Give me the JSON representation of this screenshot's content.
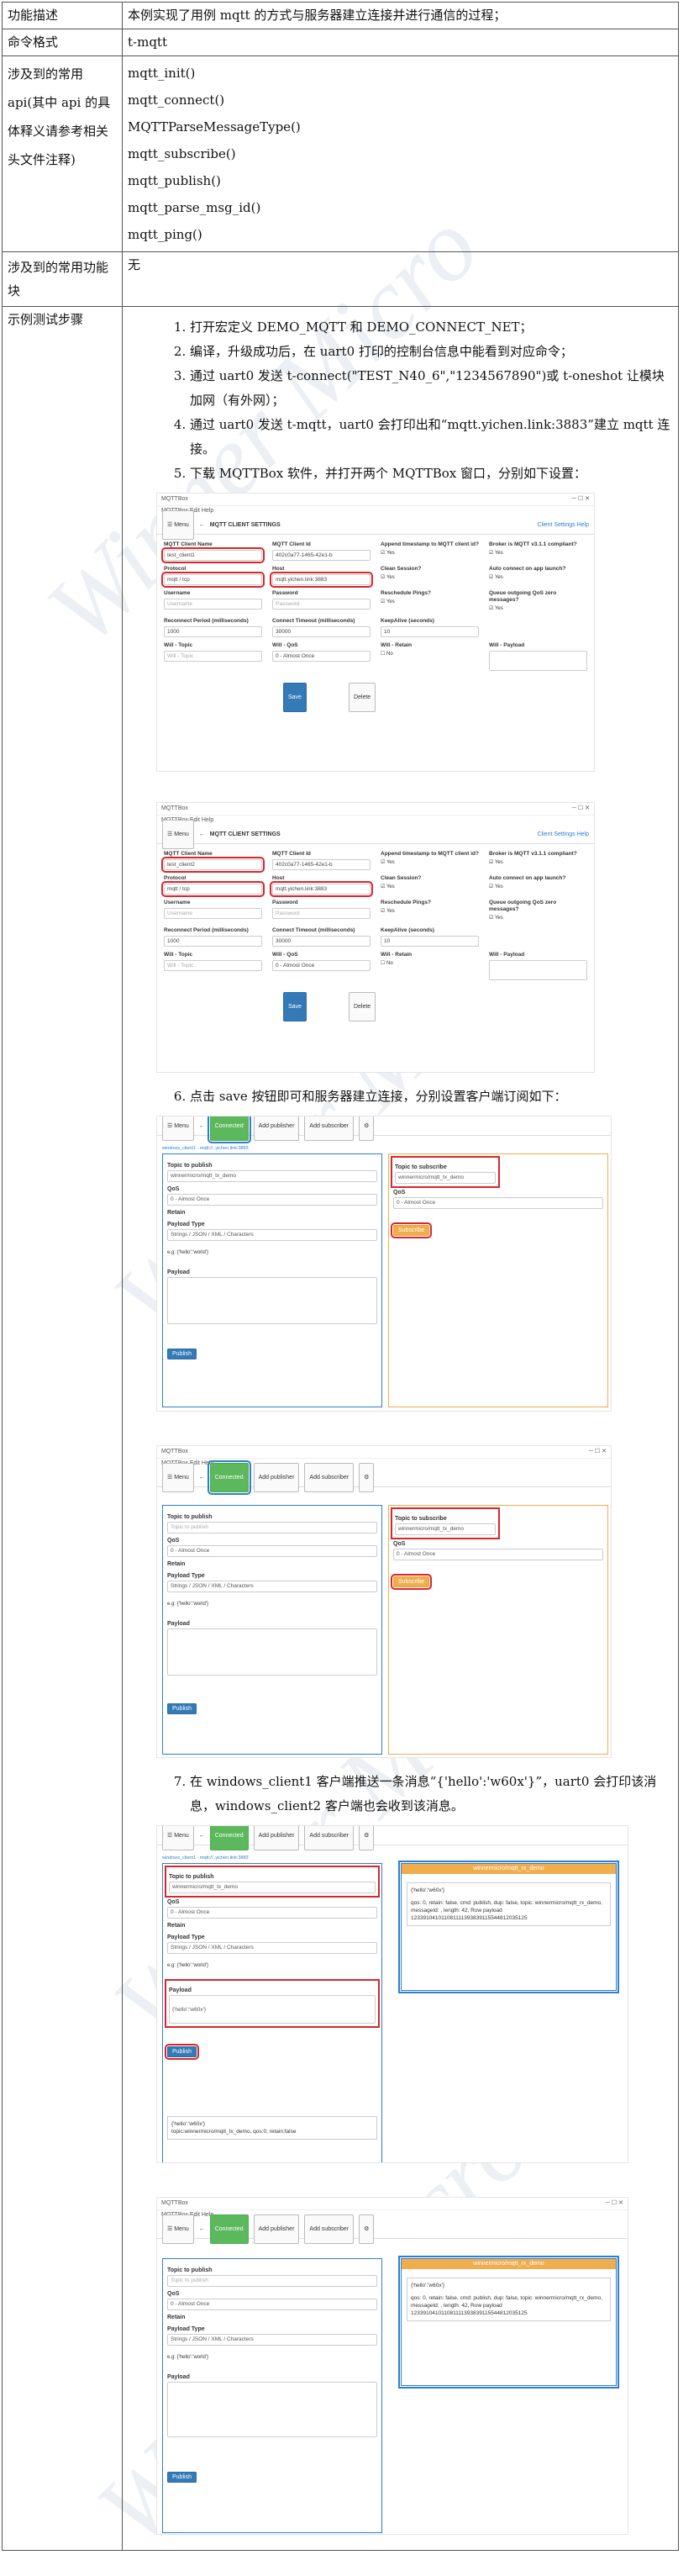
{
  "table": {
    "rows": [
      {
        "label": "功能描述",
        "value": "本例实现了用例 mqtt 的方式与服务器建立连接并进行通信的过程；"
      },
      {
        "label": "命令格式",
        "value": "t-mqtt"
      }
    ],
    "api": {
      "label": "涉及到的常用 api(其中 api 的具体释义请参考相关头文件注释)",
      "items": [
        "mqtt_init()",
        "mqtt_connect()",
        "MQTTParseMessageType()",
        "mqtt_subscribe()",
        "mqtt_publish()",
        "mqtt_parse_msg_id()",
        "mqtt_ping()"
      ]
    },
    "modules": {
      "label": "涉及到的常用功能块",
      "value": "无"
    },
    "steps_label": "示例测试步骤",
    "steps": [
      "打开宏定义 DEMO_MQTT 和 DEMO_CONNECT_NET；",
      "编译，升级成功后，在 uart0 打印的控制台信息中能看到对应命令；",
      "通过 uart0 发送 t-connect(\"TEST_N40_6\",\"1234567890\")或 t-oneshot 让模块加网（有外网）；",
      "通过 uart0 发送 t-mqtt，uart0 会打印出和“mqtt.yichen.link:3883”建立 mqtt 连接。",
      "下载 MQTTBox 软件，并打开两个 MQTTBox 窗口，分别如下设置：",
      "点击 save 按钮即可和服务器建立连接，分别设置客户端订阅如下：",
      "在 windows_client1 客户端推送一条消息“{'hello':'w60x'}”，uart0 会打印该消息，windows_client2 客户端也会收到该消息。"
    ]
  },
  "watermark": "Winner Micro",
  "mqttbox": {
    "app_title": "MQTTBox",
    "menu": [
      "MQTTBox",
      "Edit",
      "Help"
    ],
    "menu_button": "☰ Menu",
    "settings_title": "MQTT CLIENT SETTINGS",
    "settings_help": "Client Settings Help",
    "fields": {
      "client_name_label": "MQTT Client Name",
      "client_id_label": "MQTT Client Id",
      "append_ts_label": "Append timestamp to MQTT client id?",
      "broker_label": "Broker is MQTT v3.1.1 compliant?",
      "protocol_label": "Protocol",
      "protocol_value": "mqtt / tcp",
      "host_label": "Host",
      "host_value": "mqtt.yichen.link:3883",
      "clean_label": "Clean Session?",
      "auto_label": "Auto connect on app launch?",
      "username_label": "Username",
      "username_ph": "Username",
      "password_label": "Password",
      "password_ph": "Password",
      "reschedule_label": "Reschedule Pings?",
      "queue_label": "Queue outgoing QoS zero messages?",
      "reconnect_label": "Reconnect Period (milliseconds)",
      "reconnect_value": "1000",
      "timeout_label": "Connect Timeout (milliseconds)",
      "timeout_value": "30000",
      "keepalive_label": "KeepAlive (seconds)",
      "keepalive_value": "10",
      "will_topic_label": "Will - Topic",
      "will_topic_ph": "Will - Topic",
      "will_qos_label": "Will - QoS",
      "will_qos_value": "0 - Almost Once",
      "will_retain_label": "Will - Retain",
      "will_payload_label": "Will - Payload",
      "yes": "Yes",
      "no": "No",
      "save": "Save",
      "delete": "Delete"
    },
    "client1": {
      "name": "test_client1",
      "id": "402c0a77-1465-42e1-b"
    },
    "client2": {
      "name": "test_client2",
      "id": "402c0a77-1465-42e1-b"
    },
    "conn": {
      "connected": "Connected",
      "add_publisher": "Add publisher",
      "add_subscriber": "Add subscriber",
      "crumb": "windows_client1 - mqtt://..yichen.link:3883",
      "topic_publish_label": "Topic to publish",
      "topic_publish_ph": "Topic to publish",
      "topic_publish_value": "winnermicro/mqtt_tx_demo",
      "qos_label": "QoS",
      "qos_value": "0 - Almost Once",
      "retain_label": "Retain",
      "payload_type_label": "Payload Type",
      "payload_type_value": "Strings / JSON / XML / Characters",
      "payload_eg": "e.g: {'hello':'world'}",
      "payload_label": "Payload",
      "payload_value": "{'hello':'w60x'}",
      "publish": "Publish",
      "topic_subscribe_label": "Topic to subscribe",
      "topic_subscribe_value": "winnermicro/mqtt_tx_demo",
      "subscribe": "Subscribe",
      "sub_topic_head": "winnermicro/mqtt_rx_demo",
      "recv_payload": "{'hello':'w60x'}",
      "recv_meta": "qos: 0, retain: false, cmd: publish, dup: false, topic: winnermicro/mqtt_rx_demo, messageId: , length: 42, Row payload",
      "recv_raw": "123391041011081111393839115544812035125",
      "sent_line": "topic:winnermicro/mqtt_tx_demo, qos:0, retain:false"
    }
  }
}
